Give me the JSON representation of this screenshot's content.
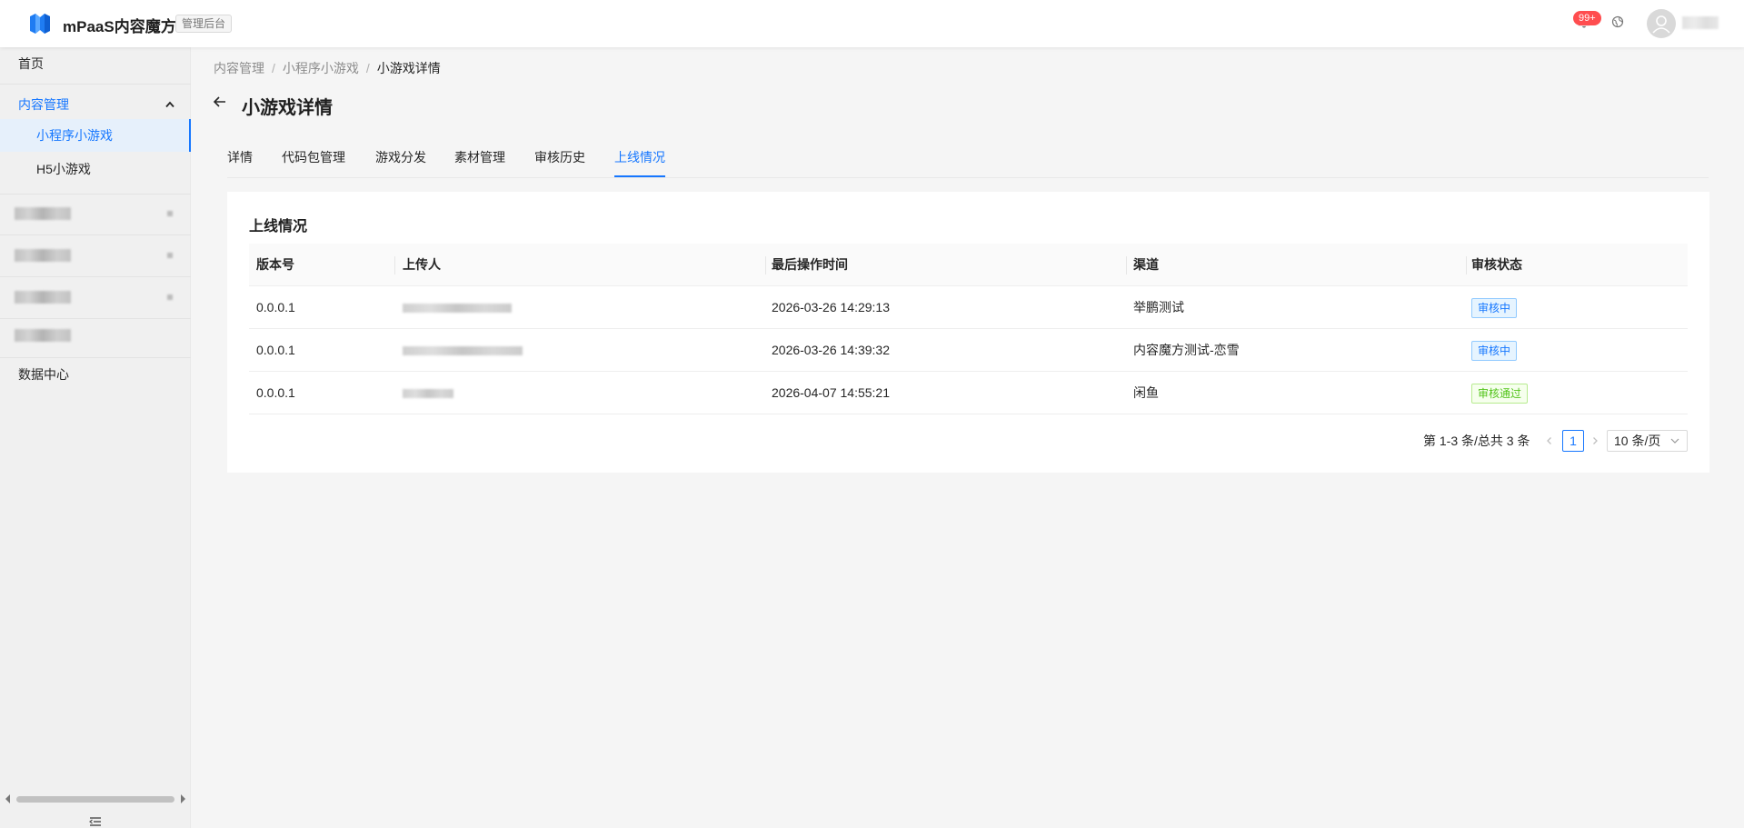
{
  "header": {
    "app_name": "mPaaS内容魔方",
    "admin_tag": "管理后台",
    "notification_count": "99+",
    "accent_color": "#1677ff"
  },
  "sidebar": {
    "home": "首页",
    "content_management": "内容管理",
    "mini_program_games": "小程序小游戏",
    "h5_games": "H5小游戏",
    "data_center": "数据中心"
  },
  "breadcrumb": {
    "items": [
      "内容管理",
      "小程序小游戏",
      "小游戏详情"
    ]
  },
  "page": {
    "title": "小游戏详情"
  },
  "tabs": [
    {
      "label": "详情"
    },
    {
      "label": "代码包管理"
    },
    {
      "label": "游戏分发"
    },
    {
      "label": "素材管理"
    },
    {
      "label": "审核历史"
    },
    {
      "label": "上线情况",
      "active": true
    }
  ],
  "section": {
    "title": "上线情况"
  },
  "table": {
    "columns": [
      "版本号",
      "上传人",
      "最后操作时间",
      "渠道",
      "审核状态"
    ],
    "rows": [
      {
        "version": "0.0.0.1",
        "time": "2026-03-26 14:29:13",
        "channel": "举鹏测试",
        "status": "审核中",
        "status_type": "blue"
      },
      {
        "version": "0.0.0.1",
        "time": "2026-03-26 14:39:32",
        "channel": "内容魔方测试-恋雪",
        "status": "审核中",
        "status_type": "blue"
      },
      {
        "version": "0.0.0.1",
        "time": "2026-04-07 14:55:21",
        "channel": "闲鱼",
        "status": "审核通过",
        "status_type": "green"
      }
    ]
  },
  "pagination": {
    "total_text": "第 1-3 条/总共 3 条",
    "current_page": "1",
    "page_size": "10 条/页"
  }
}
